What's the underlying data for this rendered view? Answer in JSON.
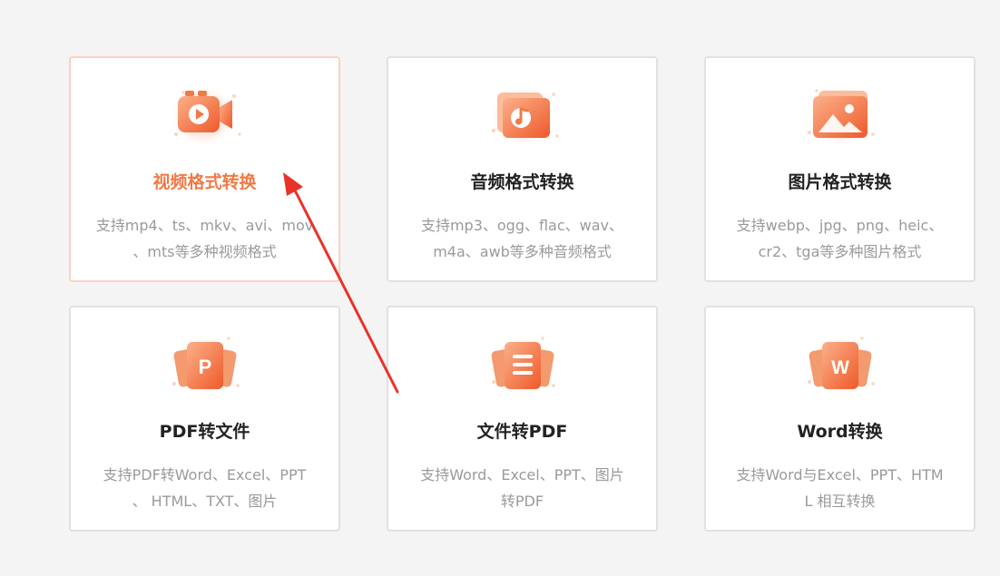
{
  "accent_color": "#f07a45",
  "cards": [
    {
      "title": "视频格式转换",
      "desc_line1": "支持mp4、ts、mkv、avi、mov",
      "desc_line2": "、mts等多种视频格式",
      "icon": "video-camera-icon",
      "selected": true
    },
    {
      "title": "音频格式转换",
      "desc_line1": "支持mp3、ogg、flac、wav、",
      "desc_line2": "m4a、awb等多种音频格式",
      "icon": "music-note-icon",
      "selected": false
    },
    {
      "title": "图片格式转换",
      "desc_line1": "支持webp、jpg、png、heic、",
      "desc_line2": "cr2、tga等多种图片格式",
      "icon": "image-icon",
      "selected": false
    },
    {
      "title": "PDF转文件",
      "desc_line1": "支持PDF转Word、Excel、PPT",
      "desc_line2": "、 HTML、TXT、图片",
      "icon": "pdf-p-icon",
      "icon_letter": "P",
      "selected": false
    },
    {
      "title": "文件转PDF",
      "desc_line1": "支持Word、Excel、PPT、图片",
      "desc_line2": "转PDF",
      "icon": "document-lines-icon",
      "selected": false
    },
    {
      "title": "Word转换",
      "desc_line1": "支持Word与Excel、PPT、HTM",
      "desc_line2": "L 相互转换",
      "icon": "word-w-icon",
      "icon_letter": "W",
      "selected": false
    }
  ]
}
